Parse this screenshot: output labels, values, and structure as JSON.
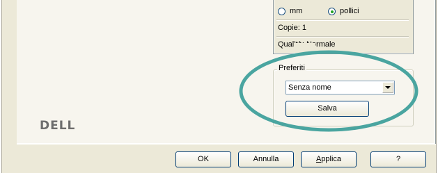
{
  "info": {
    "unit_mm_label": "mm",
    "unit_inch_label": "pollici",
    "unit_selected": "pollici",
    "copies": "Copie: 1",
    "quality": "Qualità: Normale"
  },
  "favorites": {
    "group_label": "Preferiti",
    "selected_value": "Senza nome",
    "save_label": "Salva"
  },
  "brand": {
    "logo_text": "DELL"
  },
  "buttons": {
    "ok_label": "OK",
    "cancel_label": "Annulla",
    "apply_label": "Applica",
    "help_label": "?"
  },
  "annotation": {
    "ellipse_color": "#4aa5a0"
  }
}
